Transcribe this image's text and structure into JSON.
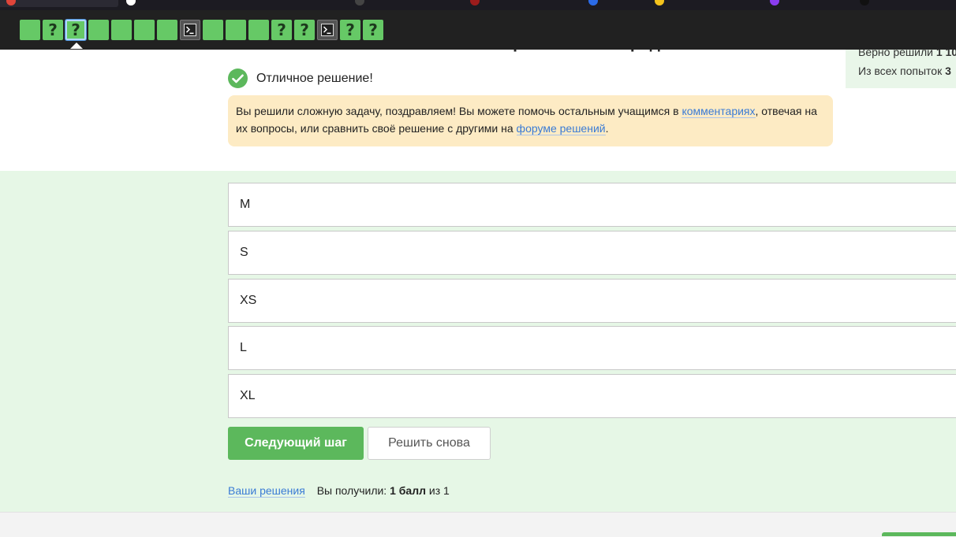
{
  "step_nav": {
    "steps": [
      {
        "type": "text",
        "glyph": ""
      },
      {
        "type": "quiz",
        "glyph": "?"
      },
      {
        "type": "quiz",
        "glyph": "?",
        "current": true
      },
      {
        "type": "text",
        "glyph": ""
      },
      {
        "type": "text",
        "glyph": ""
      },
      {
        "type": "text",
        "glyph": ""
      },
      {
        "type": "text",
        "glyph": ""
      },
      {
        "type": "code",
        "glyph": ""
      },
      {
        "type": "text",
        "glyph": ""
      },
      {
        "type": "text",
        "glyph": ""
      },
      {
        "type": "text",
        "glyph": ""
      },
      {
        "type": "quiz",
        "glyph": "?"
      },
      {
        "type": "quiz",
        "glyph": "?"
      },
      {
        "type": "code",
        "glyph": ""
      },
      {
        "type": "quiz",
        "glyph": "?"
      },
      {
        "type": "quiz",
        "glyph": "?"
      }
    ]
  },
  "step": {
    "heading": "Расположите элементы списка в правильном порядке"
  },
  "stats": {
    "correct_label": "Верно решили",
    "correct_value": "1 10",
    "attempts_label": "Из всех попыток",
    "attempts_value": "3"
  },
  "result": {
    "text": "Отличное решение!"
  },
  "congrats": {
    "part1": "Вы решили сложную задачу, поздравляем! Вы можете помочь остальным учащимся в ",
    "link1": "комментариях",
    "part2": ", отвечая на их вопросы, или сравнить своё решение с другими на ",
    "link2": "форуме решений",
    "part3": "."
  },
  "answers": [
    "M",
    "S",
    "XS",
    "L",
    "XL"
  ],
  "buttons": {
    "next": "Следующий шаг",
    "retry": "Решить снова"
  },
  "footer": {
    "your_solutions": "Ваши решения",
    "score_prefix": "Вы получили:",
    "score_value": "1 балл",
    "score_suffix": "из 1"
  },
  "colors": {
    "success": "#5cb85c",
    "step_done": "#66c966",
    "link": "#3a7bd5",
    "notice_bg": "#fdebc4",
    "solved_area_bg": "#e6f7e6"
  }
}
